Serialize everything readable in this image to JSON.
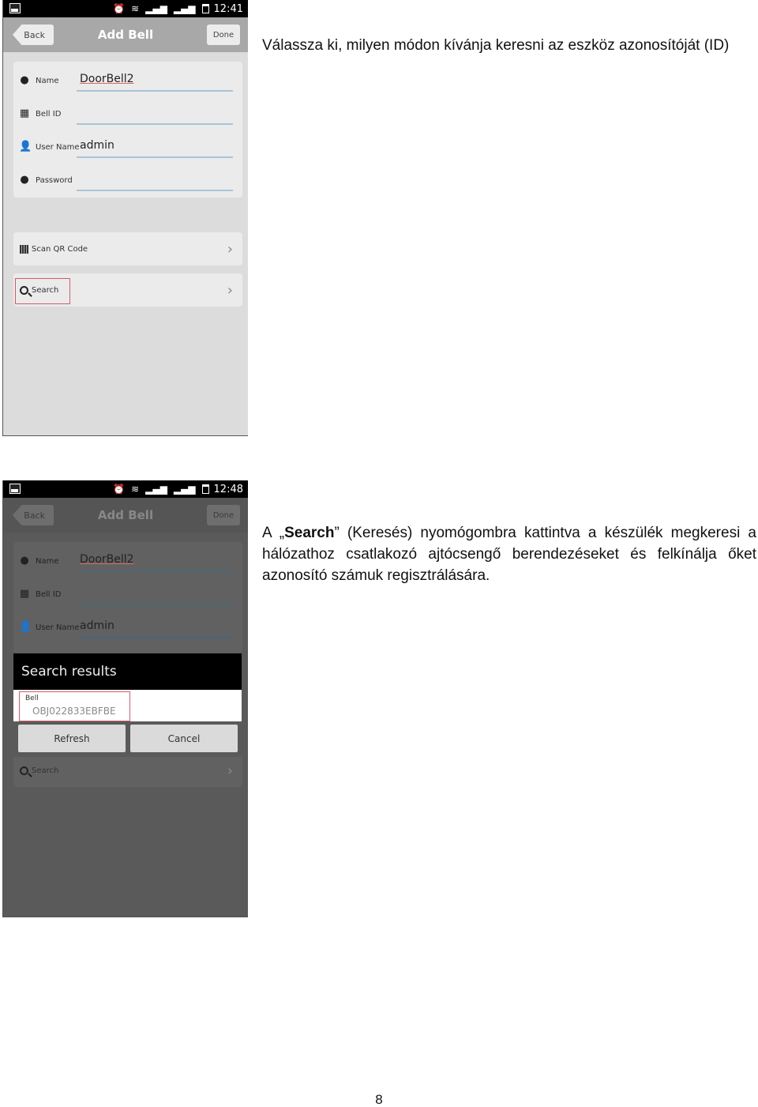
{
  "screens": [
    {
      "status_bar": {
        "time": "12:41",
        "icons": [
          "gallery-icon",
          "alarm-icon",
          "wifi-icon",
          "signal-icon",
          "signal-icon",
          "battery-icon"
        ]
      },
      "nav": {
        "back": "Back",
        "title": "Add Bell",
        "done": "Done"
      },
      "fields": [
        {
          "icon": "chat-bubble-icon",
          "label": "Name",
          "value": "DoorBell2"
        },
        {
          "icon": "grid-icon",
          "label": "Bell ID",
          "value": ""
        },
        {
          "icon": "user-icon",
          "label": "User Name",
          "value": "admin"
        },
        {
          "icon": "lock-icon",
          "label": "Password",
          "value": ""
        }
      ],
      "actions": [
        {
          "icon": "qr-code-icon",
          "label": "Scan QR Code"
        },
        {
          "icon": "search-icon",
          "label": "Search",
          "highlighted": true
        }
      ]
    },
    {
      "status_bar": {
        "time": "12:48",
        "icons": [
          "gallery-icon",
          "alarm-icon",
          "wifi-icon",
          "signal-icon",
          "signal-icon",
          "battery-icon"
        ]
      },
      "nav": {
        "back": "Back",
        "title": "Add Bell",
        "done": "Done"
      },
      "fields": [
        {
          "icon": "chat-bubble-icon",
          "label": "Name",
          "value": "DoorBell2"
        },
        {
          "icon": "grid-icon",
          "label": "Bell ID",
          "value": ""
        },
        {
          "icon": "user-icon",
          "label": "User Name",
          "value": "admin"
        }
      ],
      "actions": [
        {
          "icon": "search-icon",
          "label": "Search"
        }
      ],
      "dialog": {
        "title": "Search results",
        "items": [
          {
            "label": "Bell",
            "value": "OBJ022833EBFBE",
            "highlighted": true
          }
        ],
        "buttons": [
          "Refresh",
          "Cancel"
        ]
      }
    }
  ],
  "paragraphs": {
    "p1": "Válassza ki, milyen módon kívánja keresni az eszköz azonosítóját (ID)",
    "p2_prefix": "A „",
    "p2_bold": "Search",
    "p2_suffix": "” (Keresés) nyomógombra kattintva a készülék megkeresi a hálózathoz csatlakozó ajtócsengő berendezéseket és felkínálja őket azonosító számuk regisztrálására."
  },
  "page_number": "8",
  "colors": {
    "highlight": "#d25b6b",
    "field_line": "#a9c4d6"
  }
}
